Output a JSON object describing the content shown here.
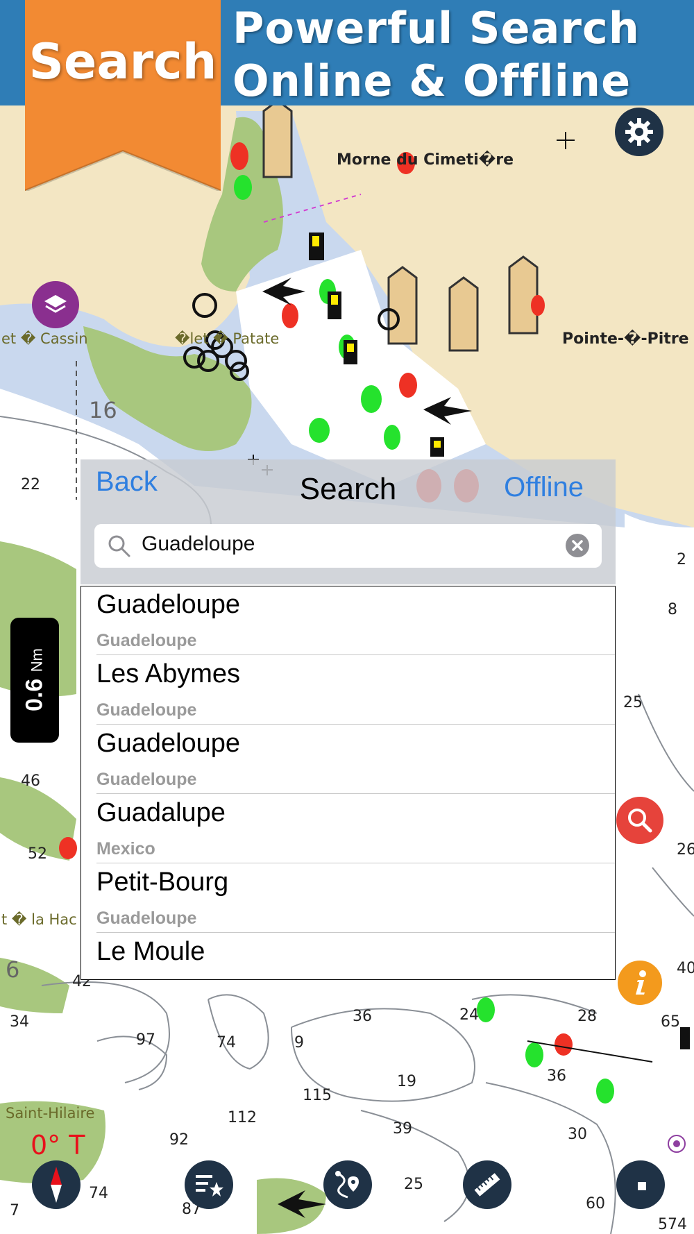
{
  "banner": {
    "ribbon_label": "Search",
    "headline_line1": "Powerful Search",
    "headline_line2": "Online & Offline",
    "colors": {
      "banner_blue": "#2f7db6",
      "ribbon_orange": "#f28a33"
    }
  },
  "map": {
    "place_labels": {
      "morne": "Morne du Cimeti�re",
      "pointe": "Pointe-�-Pitre",
      "cassin": "et � Cassin",
      "patate": "�let � Patate",
      "hache": "t � la Hac",
      "hilaire": "Saint-Hilaire"
    },
    "depths": {
      "d1": "16",
      "d2": "22",
      "d3": "2",
      "d4": "8",
      "d5": "25",
      "d6": "46",
      "d7": "52",
      "d8": "26",
      "d9": "40",
      "d10": "6",
      "d11": "42",
      "d12": "34",
      "d13": "97",
      "d14": "74",
      "d15": "9",
      "d16": "36",
      "d17": "24",
      "d18": "28",
      "d19": "65",
      "d20": "19",
      "d21": "115",
      "d22": "36",
      "d23": "112",
      "d24": "92",
      "d25": "39",
      "d26": "30",
      "d27": "74",
      "d28": "87",
      "d29": "25",
      "d30": "60",
      "d31": "574",
      "d32": "7"
    },
    "scale": {
      "value": "0.6",
      "unit": "Nm"
    },
    "heading": "0° T"
  },
  "search_panel": {
    "back_label": "Back",
    "title": "Search",
    "offline_label": "Offline",
    "query": "Guadeloupe",
    "results": [
      {
        "name": "Guadeloupe",
        "region": "Guadeloupe"
      },
      {
        "name": "Les Abymes",
        "region": "Guadeloupe"
      },
      {
        "name": "Guadeloupe",
        "region": "Guadeloupe"
      },
      {
        "name": "Guadalupe",
        "region": "Mexico"
      },
      {
        "name": "Petit-Bourg",
        "region": "Guadeloupe"
      },
      {
        "name": "Le Moule",
        "region": ""
      }
    ]
  },
  "toolbar_icons": [
    "compass-icon",
    "favorites-list-icon",
    "route-icon",
    "ruler-icon",
    "stop-icon"
  ],
  "side_buttons": [
    "settings-gear-icon",
    "layers-icon",
    "search-magnifier-icon",
    "info-icon"
  ]
}
